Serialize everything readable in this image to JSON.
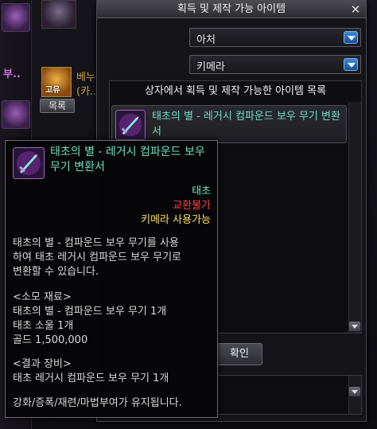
{
  "background": {
    "strip_text_1": "부..",
    "item_line_1": "베누스/나벨 고유 ...",
    "item_line_2": "(카...",
    "item_icon_tag": "고유",
    "list_button_label": "목록"
  },
  "panel": {
    "title": "획득 및 제작 가능 아이템",
    "close_glyph": "✕",
    "class_dropdown": {
      "value": "아처"
    },
    "character_dropdown": {
      "value": "키메라"
    },
    "list_header": "상자에서 획득 및 제작 가능한 아이템 목록",
    "list_items": [
      {
        "name": "태초의 별 - 레거시 컴파운드 보우 무기 변환서"
      }
    ],
    "confirm_label": "확인"
  },
  "tooltip": {
    "name": "태초의 별 - 레거시 컴파운드 보우 무기 변환서",
    "rarity": "태초",
    "trade": "교환불가",
    "usable": "키메라 사용가능",
    "description_lines": [
      "태초의 별 - 컴파운드 보우 무기를 사용",
      "하여 태초 레거시 컴파운드 보우 무기로",
      "변환할 수 있습니다."
    ],
    "materials_header": "<소모 재료>",
    "materials": [
      "태초의 별 - 컴파운드 보우 무기 1개",
      "태초 소울 1개",
      "골드 1,500,000"
    ],
    "result_header": "<결과 장비>",
    "result": "태초 레거시 컴파운드 보우 무기 1개",
    "note": "강화/증폭/재련/마법부여가 유지됩니다."
  },
  "colors": {
    "item_name": "#6fe0c0",
    "rarity": "#6fe0c0",
    "trade": "#ff4040",
    "usable": "#ffe060"
  },
  "icons": {
    "item": "purple-scroll-icon",
    "dropdown_arrow": "chevron-down-icon",
    "close": "close-icon"
  }
}
